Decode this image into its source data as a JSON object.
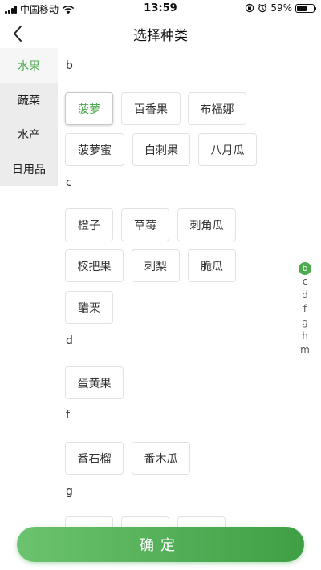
{
  "status_bar": {
    "carrier": "中国移动",
    "time": "13:59",
    "battery": "59%",
    "battery_level": 0.59
  },
  "nav": {
    "title": "选择种类",
    "back_icon": "chevron-left-icon"
  },
  "categories": [
    {
      "label": "水果",
      "active": true
    },
    {
      "label": "蔬菜",
      "active": false
    },
    {
      "label": "水产",
      "active": false
    },
    {
      "label": "日用品",
      "active": false
    }
  ],
  "groups": [
    {
      "letter": "b",
      "items": [
        "菠萝",
        "百香果",
        "布福娜",
        "菠萝蜜",
        "白刺果",
        "八月瓜"
      ]
    },
    {
      "letter": "c",
      "items": [
        "橙子",
        "草莓",
        "刺角瓜",
        "杈把果",
        "刺梨",
        "脆瓜",
        "醋栗"
      ]
    },
    {
      "letter": "d",
      "items": [
        "蛋黄果"
      ]
    },
    {
      "letter": "f",
      "items": [
        "番石榴",
        "番木瓜"
      ]
    },
    {
      "letter": "g",
      "items": []
    }
  ],
  "selected_item": "菠萝",
  "index_letters": [
    "b",
    "c",
    "d",
    "f",
    "g",
    "h",
    "m"
  ],
  "active_index": "b",
  "confirm_label": "确定",
  "colors": {
    "accent": "#4caa4e",
    "button_start": "#6cc36f",
    "button_end": "#3f9f44"
  }
}
